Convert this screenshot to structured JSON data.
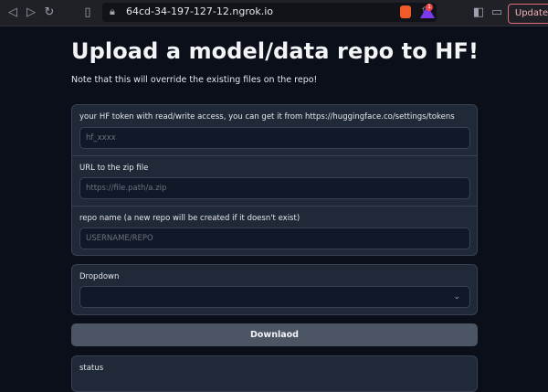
{
  "browser": {
    "url": "64cd-34-197-127-12.ngrok.io",
    "update_label": "Update",
    "notification_count": "1"
  },
  "page": {
    "title": "Upload a model/data repo to HF!",
    "note": "Note that this will override the existing files on the repo!"
  },
  "form": {
    "token": {
      "label": "your HF token with read/write access, you can get it from https://huggingface.co/settings/tokens",
      "placeholder": "hf_xxxx",
      "value": ""
    },
    "zip_url": {
      "label": "URL to the zip file",
      "placeholder": "https://file.path/a.zip",
      "value": ""
    },
    "repo_name": {
      "label": "repo name (a new repo will be created if it doesn't exist)",
      "placeholder": "USERNAME/REPO",
      "value": ""
    }
  },
  "dropdown": {
    "label": "Dropdown",
    "selected": ""
  },
  "download_button": {
    "label": "Downlaod"
  },
  "status": {
    "label": "status"
  }
}
